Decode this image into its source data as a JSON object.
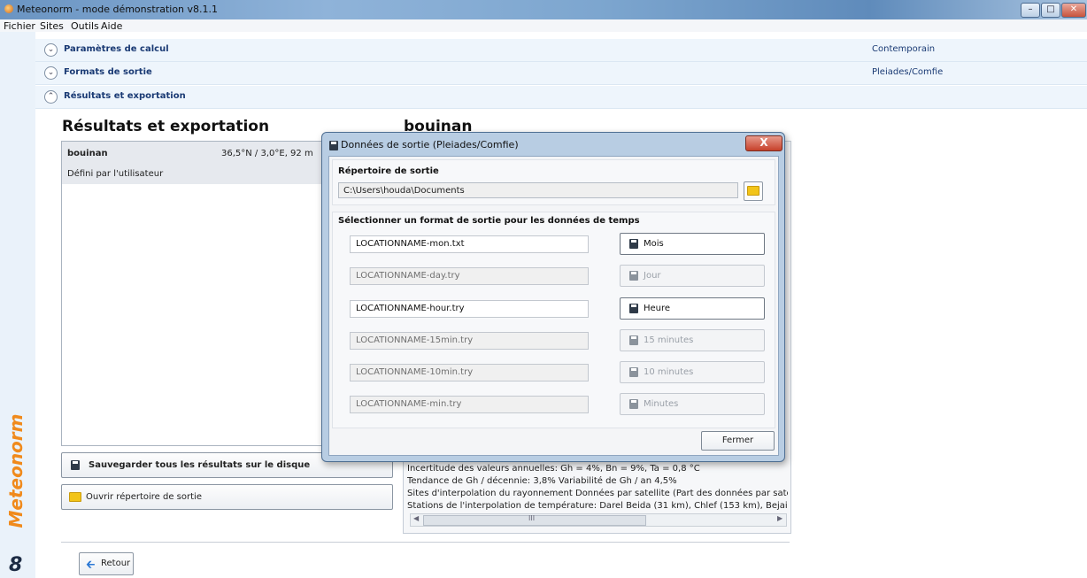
{
  "window": {
    "title": "Meteonorm - mode démonstration v8.1.1"
  },
  "menu": [
    "Fichier",
    "Sites",
    "Outils",
    "Aide"
  ],
  "brand": {
    "name": "Meteonorm",
    "version": "8"
  },
  "expanders": [
    {
      "label": "Paramètres de calcul",
      "value": "Contemporain",
      "expanded": false
    },
    {
      "label": "Formats de sortie",
      "value": "Pleiades/Comfie",
      "expanded": false
    },
    {
      "label": "Résultats et exportation",
      "value": "",
      "expanded": true
    }
  ],
  "results": {
    "heading": "Résultats et exportation",
    "site": {
      "name": "bouinan",
      "coords": "36,5°N / 3,0°E, 92 m",
      "type": "Défini par l'utilisateur"
    },
    "save_all_label": "Sauvegarder tous les résultats sur le disque",
    "open_dir_label": "Ouvrir répertoire de sortie"
  },
  "site_panel": {
    "heading": "bouinan",
    "info_lines": [
      "Incertitude des valeurs annuelles: Gh = 4%, Bn = 9%, Ta = 0,8 °C",
      "Tendance de Gh / décennie: 3,8%   Variabilité de Gh / an 4,5%",
      "Sites d'interpolation du rayonnement Données par satellite  (Part des données par satelli",
      "Stations de l'interpolation de température: Darel Beida (31 km), Chlef (153 km), Bejaia/Sc"
    ],
    "scroll_grip": "III"
  },
  "back_button": "Retour",
  "dialog": {
    "title": "Données de sortie (Pleiades/Comfie)",
    "close_glyph": "X",
    "dir_label": "Répertoire de sortie",
    "dir_path": "C:\\Users\\houda\\Documents",
    "format_label": "Sélectionner un format de sortie pour les données de temps",
    "formats": [
      {
        "file": "LOCATIONNAME-mon.txt",
        "button": "Mois",
        "enabled": true
      },
      {
        "file": "LOCATIONNAME-day.try",
        "button": "Jour",
        "enabled": false
      },
      {
        "file": "LOCATIONNAME-hour.try",
        "button": "Heure",
        "enabled": true
      },
      {
        "file": "LOCATIONNAME-15min.try",
        "button": "15 minutes",
        "enabled": false
      },
      {
        "file": "LOCATIONNAME-10min.try",
        "button": "10 minutes",
        "enabled": false
      },
      {
        "file": "LOCATIONNAME-min.try",
        "button": "Minutes",
        "enabled": false
      }
    ],
    "close_label": "Fermer"
  }
}
